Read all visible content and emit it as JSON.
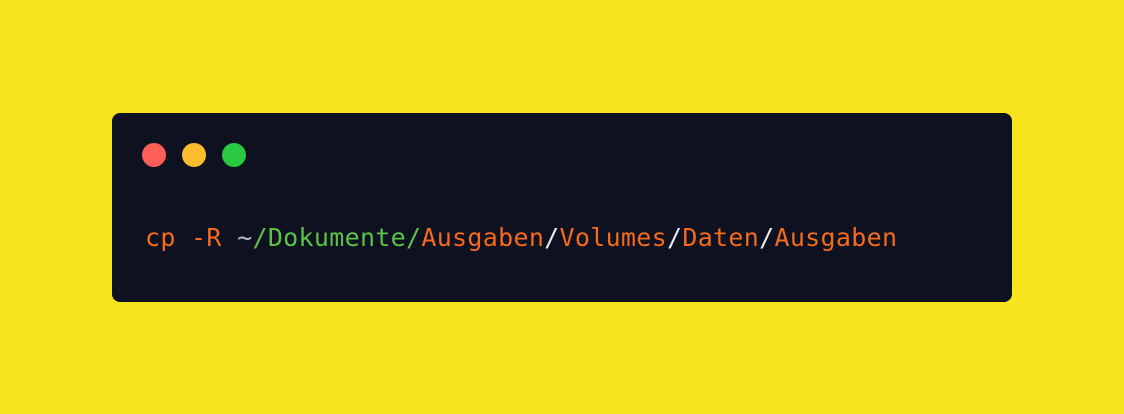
{
  "colors": {
    "background": "#f8e51e",
    "terminal_bg": "#0e1120",
    "close_light": "#ff5f57",
    "minimize_light": "#febc2e",
    "maximize_light": "#28c840",
    "token_orange": "#f46a1f",
    "token_green": "#5bc247",
    "token_white": "#e8e8e8",
    "token_gray": "#b9bcc6"
  },
  "window_controls": {
    "close": "close-icon",
    "minimize": "minimize-icon",
    "maximize": "maximize-icon"
  },
  "command": {
    "name": "cp",
    "flag": "-R",
    "tilde": "~",
    "path_home": "/Dokumente/",
    "seg1": "Ausgaben",
    "sep1": "/",
    "seg2": "Volumes",
    "sep2": "/",
    "seg3": "Daten",
    "sep3": "/",
    "seg4": "Ausgaben"
  }
}
